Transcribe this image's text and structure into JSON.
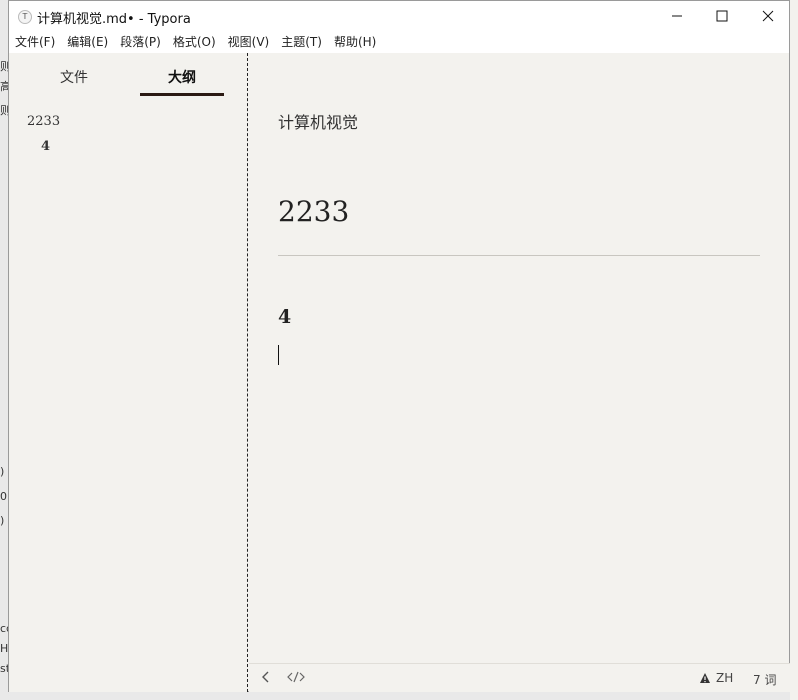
{
  "window": {
    "app_icon_glyph": "T",
    "title": "计算机视觉.md• - Typora"
  },
  "menu": {
    "items": [
      "文件(F)",
      "编辑(E)",
      "段落(P)",
      "格式(O)",
      "视图(V)",
      "主题(T)",
      "帮助(H)"
    ]
  },
  "sidebar": {
    "tabs": [
      {
        "label": "文件",
        "active": false
      },
      {
        "label": "大纲",
        "active": true
      }
    ],
    "outline": [
      {
        "label": "2233",
        "level": 1
      },
      {
        "label": "4",
        "level": 2
      }
    ]
  },
  "editor": {
    "paragraph": "计算机视觉",
    "heading1": "2233",
    "heading4": "4"
  },
  "status": {
    "back_icon": "chevron-left-icon",
    "code_icon": "code-icon",
    "warning_icon": "warning-icon",
    "lang": "ZH",
    "word_count": "7 词"
  },
  "background_fragments": [
    "则",
    "高",
    "则",
    ")",
    "0",
    ")",
    "cc",
    "H",
    "st"
  ]
}
